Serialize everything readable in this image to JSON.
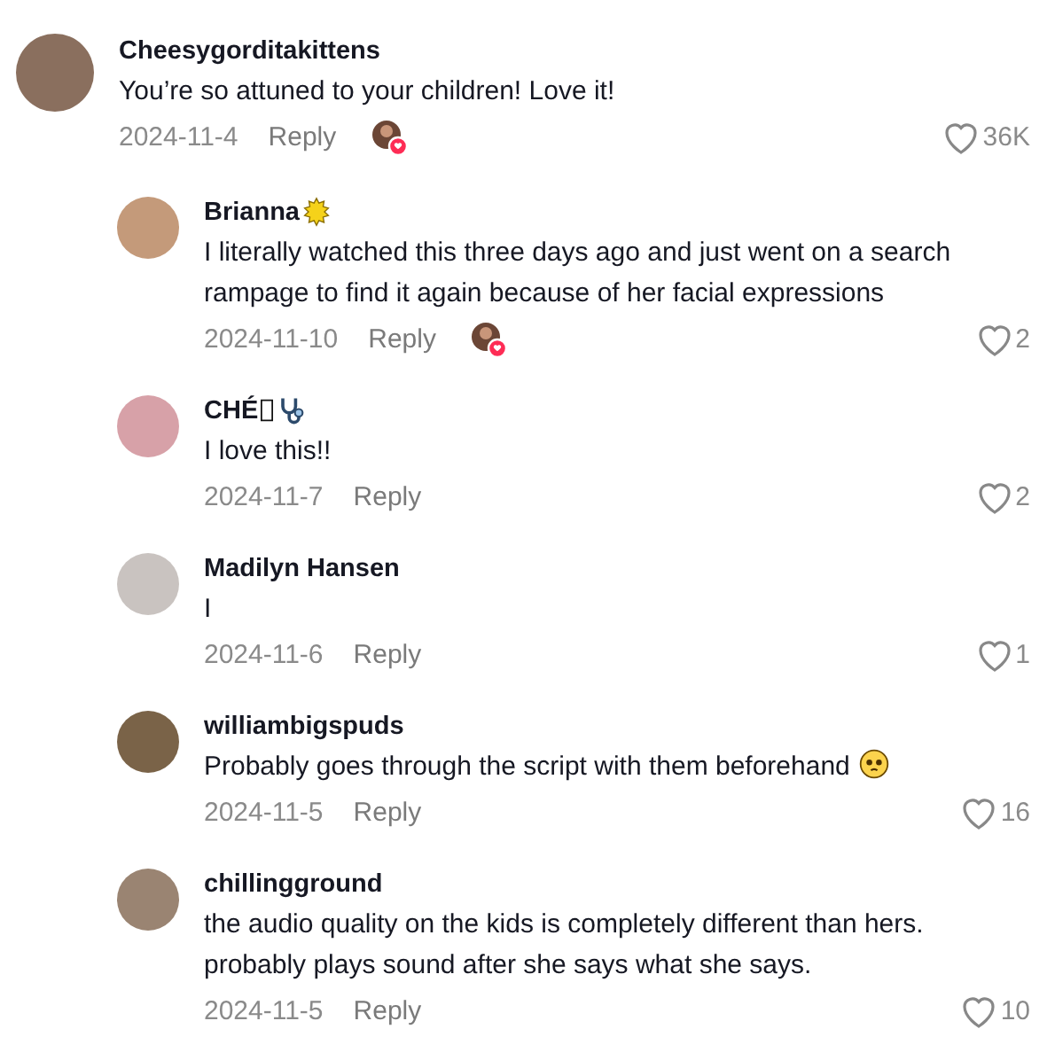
{
  "comments": [
    {
      "author": "Cheesygorditakittens",
      "text": "You’re so attuned to your children! Love it!",
      "date": "2024-11-4",
      "reply_label": "Reply",
      "creator_liked": true,
      "likes": "36K",
      "children": [
        {
          "author": "Brianna",
          "name_icons": [
            {
              "kind": "sun"
            }
          ],
          "text": "I literally watched this three days ago and just went on a search rampage to find it again because of her facial expressions",
          "date": "2024-11-10",
          "reply_label": "Reply",
          "creator_liked": true,
          "likes": "2"
        },
        {
          "author": "CHÉ",
          "name_icons": [
            {
              "kind": "missing-glyph"
            },
            {
              "kind": "stethoscope"
            }
          ],
          "text": "I love this!!",
          "date": "2024-11-7",
          "reply_label": "Reply",
          "creator_liked": false,
          "likes": "2"
        },
        {
          "author": "Madilyn Hansen",
          "text": "I",
          "date": "2024-11-6",
          "reply_label": "Reply",
          "creator_liked": false,
          "likes": "1"
        },
        {
          "author": "williambigspuds",
          "text": "Probably goes through the script with them beforehand",
          "text_icons": [
            {
              "kind": "pleading-face"
            }
          ],
          "date": "2024-11-5",
          "reply_label": "Reply",
          "creator_liked": false,
          "likes": "16"
        },
        {
          "author": "chillingground",
          "text": "the audio quality on the kids is completely different than hers. probably plays sound after she says what she says.",
          "date": "2024-11-5",
          "reply_label": "Reply",
          "creator_liked": false,
          "likes": "10"
        }
      ]
    }
  ]
}
